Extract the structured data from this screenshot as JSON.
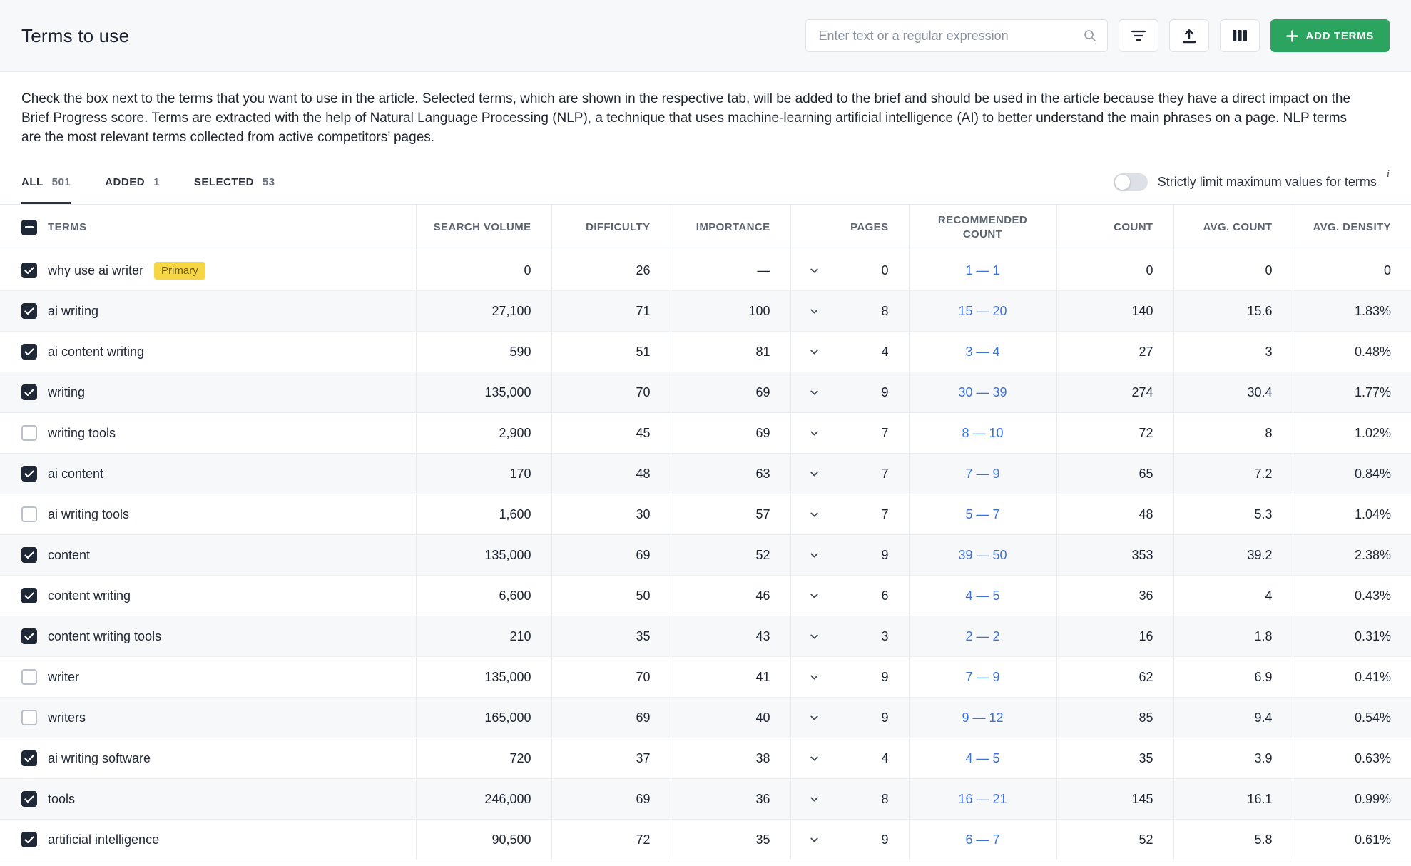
{
  "header": {
    "title": "Terms to use",
    "search_placeholder": "Enter text or a regular expression",
    "add_terms_label": "ADD TERMS"
  },
  "description": "Check the box next to the terms that you want to use in the article. Selected terms, which are shown in the respective tab, will be added to the brief and should be used in the article because they have a direct impact on the Brief Progress score. Terms are extracted with the help of Natural Language Processing (NLP), a technique that uses machine-learning artificial intelligence (AI) to better understand the main phrases on a page. NLP terms are the most relevant terms collected from active competitors’ pages.",
  "tabs": [
    {
      "label": "ALL",
      "count": "501",
      "active": true
    },
    {
      "label": "ADDED",
      "count": "1",
      "active": false
    },
    {
      "label": "SELECTED",
      "count": "53",
      "active": false
    }
  ],
  "toggle": {
    "label": "Strictly limit maximum values for terms",
    "state": "off",
    "info_icon": "i"
  },
  "colors": {
    "accent_green": "#2BA45F",
    "link_blue": "#3B72DE",
    "badge_yellow": "#F6D645",
    "checkbox_dark": "#1F2836"
  },
  "table": {
    "columns": [
      "TERMS",
      "SEARCH VOLUME",
      "DIFFICULTY",
      "IMPORTANCE",
      "PAGES",
      "RECOMMENDED COUNT",
      "COUNT",
      "AVG. COUNT",
      "AVG. DENSITY"
    ],
    "header_checkbox_state": "indeterminate",
    "rows": [
      {
        "term": "why use ai writer",
        "badge": "Primary",
        "checked": true,
        "search_volume": "0",
        "difficulty": "26",
        "importance": "—",
        "pages": "0",
        "recommended": "1 — 1",
        "count": "0",
        "avg_count": "0",
        "avg_density": "0"
      },
      {
        "term": "ai writing",
        "badge": null,
        "checked": true,
        "search_volume": "27,100",
        "difficulty": "71",
        "importance": "100",
        "pages": "8",
        "recommended": "15 — 20",
        "count": "140",
        "avg_count": "15.6",
        "avg_density": "1.83%"
      },
      {
        "term": "ai content writing",
        "badge": null,
        "checked": true,
        "search_volume": "590",
        "difficulty": "51",
        "importance": "81",
        "pages": "4",
        "recommended": "3 — 4",
        "count": "27",
        "avg_count": "3",
        "avg_density": "0.48%"
      },
      {
        "term": "writing",
        "badge": null,
        "checked": true,
        "search_volume": "135,000",
        "difficulty": "70",
        "importance": "69",
        "pages": "9",
        "recommended": "30 — 39",
        "count": "274",
        "avg_count": "30.4",
        "avg_density": "1.77%"
      },
      {
        "term": "writing tools",
        "badge": null,
        "checked": false,
        "search_volume": "2,900",
        "difficulty": "45",
        "importance": "69",
        "pages": "7",
        "recommended": "8 — 10",
        "count": "72",
        "avg_count": "8",
        "avg_density": "1.02%"
      },
      {
        "term": "ai content",
        "badge": null,
        "checked": true,
        "search_volume": "170",
        "difficulty": "48",
        "importance": "63",
        "pages": "7",
        "recommended": "7 — 9",
        "count": "65",
        "avg_count": "7.2",
        "avg_density": "0.84%"
      },
      {
        "term": "ai writing tools",
        "badge": null,
        "checked": false,
        "search_volume": "1,600",
        "difficulty": "30",
        "importance": "57",
        "pages": "7",
        "recommended": "5 — 7",
        "count": "48",
        "avg_count": "5.3",
        "avg_density": "1.04%"
      },
      {
        "term": "content",
        "badge": null,
        "checked": true,
        "search_volume": "135,000",
        "difficulty": "69",
        "importance": "52",
        "pages": "9",
        "recommended": "39 — 50",
        "count": "353",
        "avg_count": "39.2",
        "avg_density": "2.38%"
      },
      {
        "term": "content writing",
        "badge": null,
        "checked": true,
        "search_volume": "6,600",
        "difficulty": "50",
        "importance": "46",
        "pages": "6",
        "recommended": "4 — 5",
        "count": "36",
        "avg_count": "4",
        "avg_density": "0.43%"
      },
      {
        "term": "content writing tools",
        "badge": null,
        "checked": true,
        "search_volume": "210",
        "difficulty": "35",
        "importance": "43",
        "pages": "3",
        "recommended": "2 — 2",
        "count": "16",
        "avg_count": "1.8",
        "avg_density": "0.31%"
      },
      {
        "term": "writer",
        "badge": null,
        "checked": false,
        "search_volume": "135,000",
        "difficulty": "70",
        "importance": "41",
        "pages": "9",
        "recommended": "7 — 9",
        "count": "62",
        "avg_count": "6.9",
        "avg_density": "0.41%"
      },
      {
        "term": "writers",
        "badge": null,
        "checked": false,
        "search_volume": "165,000",
        "difficulty": "69",
        "importance": "40",
        "pages": "9",
        "recommended": "9 — 12",
        "count": "85",
        "avg_count": "9.4",
        "avg_density": "0.54%"
      },
      {
        "term": "ai writing software",
        "badge": null,
        "checked": true,
        "search_volume": "720",
        "difficulty": "37",
        "importance": "38",
        "pages": "4",
        "recommended": "4 — 5",
        "count": "35",
        "avg_count": "3.9",
        "avg_density": "0.63%"
      },
      {
        "term": "tools",
        "badge": null,
        "checked": true,
        "search_volume": "246,000",
        "difficulty": "69",
        "importance": "36",
        "pages": "8",
        "recommended": "16 — 21",
        "count": "145",
        "avg_count": "16.1",
        "avg_density": "0.99%"
      },
      {
        "term": "artificial intelligence",
        "badge": null,
        "checked": true,
        "search_volume": "90,500",
        "difficulty": "72",
        "importance": "35",
        "pages": "9",
        "recommended": "6 — 7",
        "count": "52",
        "avg_count": "5.8",
        "avg_density": "0.61%"
      }
    ]
  }
}
